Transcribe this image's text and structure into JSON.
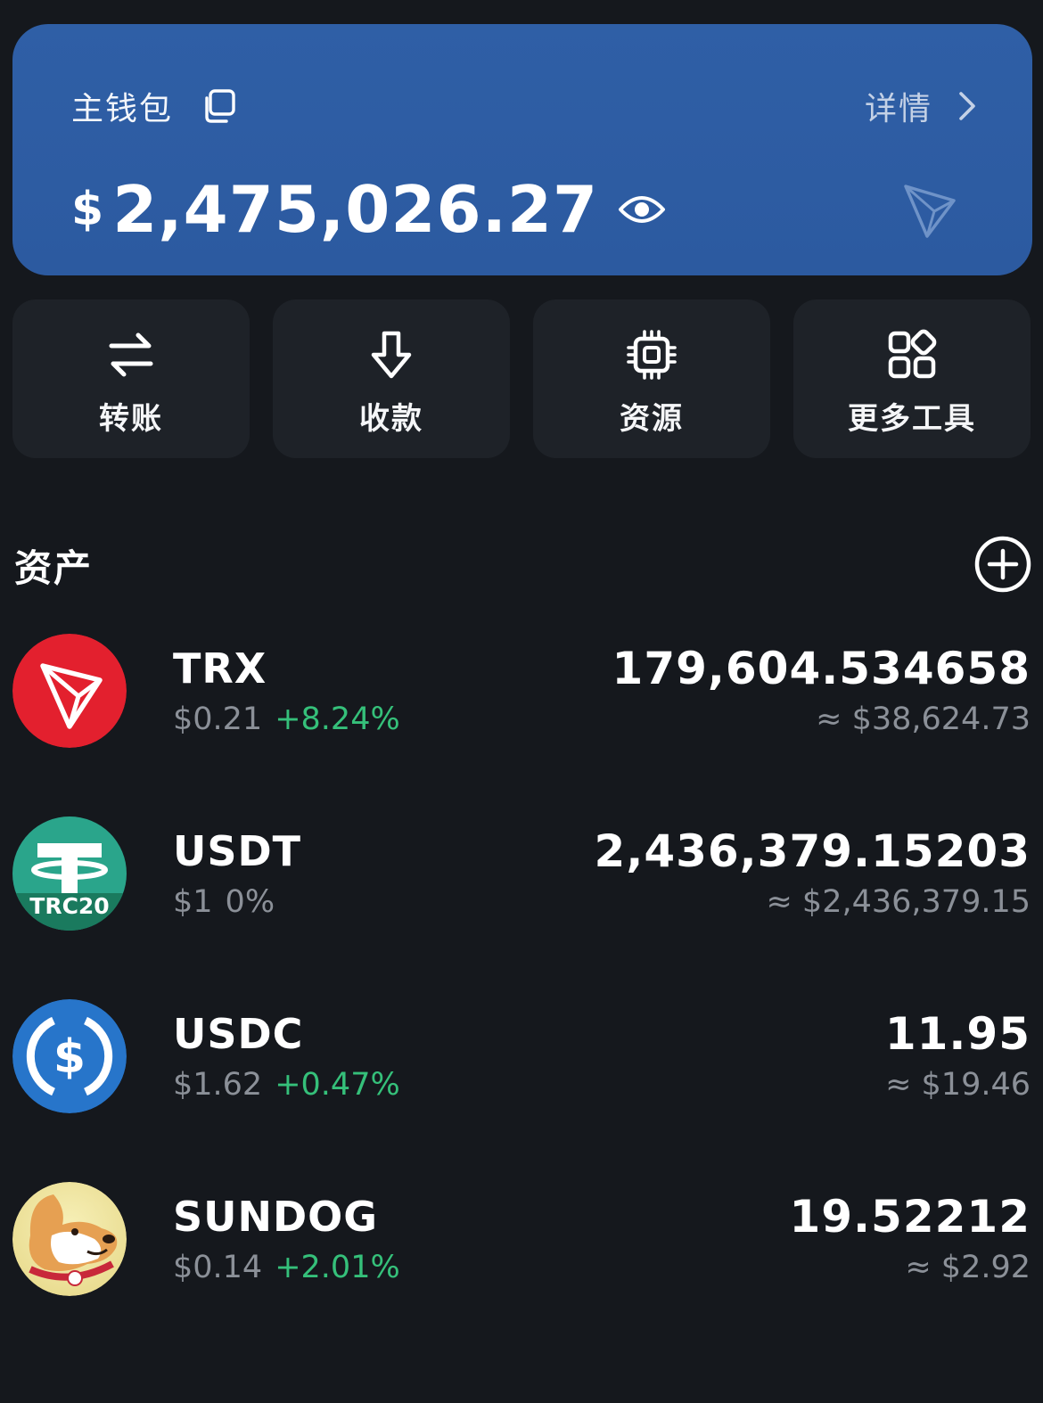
{
  "wallet": {
    "name": "主钱包",
    "details_label": "详情",
    "currency_symbol": "$",
    "balance": "2,475,026.27",
    "icons": [
      "copy-icon",
      "chevron-right-icon",
      "eye-icon",
      "tron-logo-icon"
    ],
    "card_color": "#2d5ca3"
  },
  "actions": [
    {
      "label": "转账",
      "icon": "transfer-icon"
    },
    {
      "label": "收款",
      "icon": "receive-icon"
    },
    {
      "label": "资源",
      "icon": "chip-icon"
    },
    {
      "label": "更多工具",
      "icon": "apps-grid-icon"
    }
  ],
  "assets": {
    "title": "资产",
    "add_icon": "plus-circle-icon",
    "items": [
      {
        "symbol": "TRX",
        "price": "$0.21",
        "change": "+8.24%",
        "amount": "179,604.534658",
        "value": "≈ $38,624.73",
        "logo": "trx-logo"
      },
      {
        "symbol": "USDT",
        "price": "$1",
        "change": "0%",
        "amount": "2,436,379.15203",
        "value": "≈ $2,436,379.15",
        "logo": "usdt-logo",
        "badge": "TRC20"
      },
      {
        "symbol": "USDC",
        "price": "$1.62",
        "change": "+0.47%",
        "amount": "11.95",
        "value": "≈ $19.46",
        "logo": "usdc-logo"
      },
      {
        "symbol": "SUNDOG",
        "price": "$0.14",
        "change": "+2.01%",
        "amount": "19.52212",
        "value": "≈ $2.92",
        "logo": "sundog-logo"
      }
    ]
  },
  "colors": {
    "positive": "#35c07a",
    "neutral": "#8b9098",
    "background": "#15181d",
    "tile": "#1e2228"
  }
}
